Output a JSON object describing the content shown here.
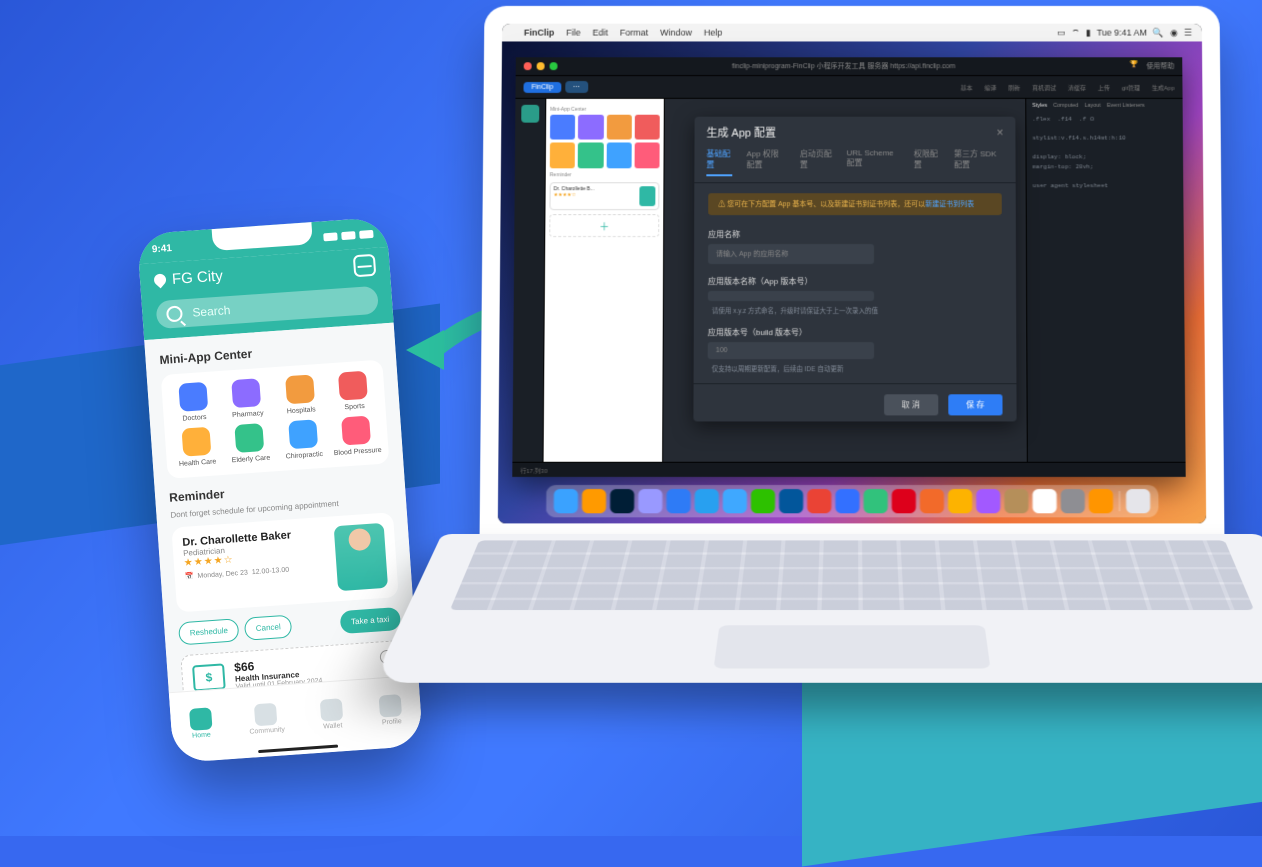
{
  "phone": {
    "status_time": "9:41",
    "location_label": "FG City",
    "search_placeholder": "Search",
    "miniapp_center_title": "Mini-App Center",
    "apps": [
      {
        "id": "doctors",
        "label": "Doctors",
        "color": "#4a7cff"
      },
      {
        "id": "pharmacy",
        "label": "Pharmacy",
        "color": "#8c6cff"
      },
      {
        "id": "hospitals",
        "label": "Hospitals",
        "color": "#f29b3f"
      },
      {
        "id": "sports",
        "label": "Sports",
        "color": "#f05c5c"
      },
      {
        "id": "health-care",
        "label": "Health Care",
        "color": "#ffb03a"
      },
      {
        "id": "elderly-care",
        "label": "Elderly Care",
        "color": "#34c28a"
      },
      {
        "id": "chiropractic",
        "label": "Chiropractic",
        "color": "#3fa2ff"
      },
      {
        "id": "blood-pressure",
        "label": "Blood Pressure",
        "color": "#ff5c7a"
      }
    ],
    "reminder_title": "Reminder",
    "reminder_sub": "Dont forget schedule for upcoming appointment",
    "doctor": {
      "name": "Dr. Charollette Baker",
      "speciality": "Pediatrician",
      "stars": "★★★★☆",
      "date": "Monday, Dec 23",
      "time": "12.00-13.00"
    },
    "actions": {
      "reschedule": "Reshedule",
      "cancel": "Cancel",
      "taxi": "Take a taxi"
    },
    "insurance": {
      "ticket_symbol": "$",
      "price": "$66",
      "plan": "Health Insurance",
      "valid": "Valid until 01 February 2024"
    },
    "tabs": [
      {
        "id": "home",
        "label": "Home",
        "active": true
      },
      {
        "id": "community",
        "label": "Community",
        "active": false
      },
      {
        "id": "wallet",
        "label": "Wallet",
        "active": false
      },
      {
        "id": "profile",
        "label": "Profile",
        "active": false
      }
    ]
  },
  "mac_menubar": {
    "app": "FinClip",
    "items": [
      "File",
      "Edit",
      "Format",
      "Window",
      "Help"
    ],
    "time": "Tue 9:41 AM"
  },
  "ide": {
    "window_title": "finclip-miniprogram-FinClip 小程序开发工具 服务器 https://api.finclip.com",
    "toolbar_label": "FinClip",
    "toolbar_items": [
      "基本",
      "编译",
      "刷新",
      "真机调试",
      "清缓存",
      "上传",
      "git管理",
      "生成App"
    ],
    "right_toolbar": "使用帮助",
    "preview_section1": "Mini-App Center",
    "preview_section2": "Reminder",
    "preview_doctor": "Dr. Charollette B...",
    "right_panel_tabs": [
      "Styles",
      "Computed",
      "Layout",
      "Event Listeners"
    ],
    "right_code": ".flex  .f14  .f ⊙\n\nstylist:v.f14.s.h14mt:h:10\n\ndisplay: block;\nmargin-top: 20vh;\n\nuser agent stylesheet",
    "status_bar": "行17,列30"
  },
  "dialog": {
    "title": "生成 App 配置",
    "tabs": [
      "基础配置",
      "App 权限配置",
      "启动页配置",
      "URL Scheme 配置",
      "权限配置",
      "第三方 SDK 配置"
    ],
    "warn_text": "⚠ 您可在下方配置 App 基本号、以及新建证书到证书列表，还可以",
    "warn_link": "新建证书到列表",
    "fields": [
      {
        "label": "应用名称",
        "placeholder": "请输入 App 的应用名称",
        "help": ""
      },
      {
        "label": "应用版本名称（App 版本号）",
        "placeholder": "",
        "help": "请使用 x.y.z 方式命名，升级时请保证大于上一次录入的值"
      },
      {
        "label": "应用版本号（build 版本号）",
        "placeholder": "100",
        "help": "仅支持以周期更新配置，后续由 IDE 自动更新"
      }
    ],
    "btn_cancel": "取 消",
    "btn_ok": "保 存"
  },
  "dock": [
    {
      "id": "finder",
      "color": "#3aa2ff"
    },
    {
      "id": "illustrator",
      "color": "#ff9a00"
    },
    {
      "id": "photoshop",
      "color": "#001e36"
    },
    {
      "id": "after-effects",
      "color": "#9999ff"
    },
    {
      "id": "dingtalk",
      "color": "#2e7bf6"
    },
    {
      "id": "safari",
      "color": "#28a0f0"
    },
    {
      "id": "fliggy",
      "color": "#3fa8ff"
    },
    {
      "id": "wechat",
      "color": "#2dc100"
    },
    {
      "id": "flutter",
      "color": "#02569B"
    },
    {
      "id": "chrome",
      "color": "#ea4335"
    },
    {
      "id": "feishu",
      "color": "#3370ff"
    },
    {
      "id": "qqmusic",
      "color": "#31c27c"
    },
    {
      "id": "netease-music",
      "color": "#dd001b"
    },
    {
      "id": "wps",
      "color": "#f26a2a"
    },
    {
      "id": "sketch",
      "color": "#fdb300"
    },
    {
      "id": "figma",
      "color": "#a259ff"
    },
    {
      "id": "toolbox",
      "color": "#b58f5a"
    },
    {
      "id": "calendar",
      "color": "#ffffff"
    },
    {
      "id": "system-prefs",
      "color": "#8e8e93"
    },
    {
      "id": "pages",
      "color": "#ff9500"
    },
    {
      "id": "trash",
      "color": "#e5e5ea"
    }
  ]
}
